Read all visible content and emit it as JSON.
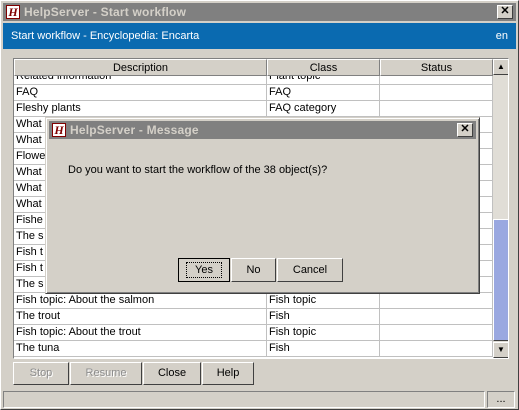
{
  "window": {
    "title": "HelpServer - Start workflow",
    "app_icon": "H",
    "close_glyph": "✕"
  },
  "header": {
    "text": "Start workflow - Encyclopedia: Encarta",
    "lang": "en",
    "background": "#0a6ab0"
  },
  "table": {
    "columns": [
      "Description",
      "Class",
      "Status"
    ],
    "rows": [
      [
        "Related information",
        "Plant topic",
        ""
      ],
      [
        "FAQ",
        "FAQ",
        ""
      ],
      [
        "Fleshy plants",
        "FAQ category",
        ""
      ],
      [
        "What",
        "",
        ""
      ],
      [
        "What",
        "",
        ""
      ],
      [
        "Flowe",
        "",
        ""
      ],
      [
        "What",
        "",
        ""
      ],
      [
        "What",
        "",
        ""
      ],
      [
        "What",
        "",
        ""
      ],
      [
        "Fishe",
        "",
        ""
      ],
      [
        "The s",
        "",
        ""
      ],
      [
        "Fish t",
        "",
        ""
      ],
      [
        "Fish t",
        "",
        ""
      ],
      [
        "The s",
        "",
        ""
      ],
      [
        "Fish topic: About the salmon",
        "Fish topic",
        ""
      ],
      [
        "The trout",
        "Fish",
        ""
      ],
      [
        "Fish topic: About the trout",
        "Fish topic",
        ""
      ],
      [
        "The tuna",
        "Fish",
        ""
      ]
    ]
  },
  "buttons": {
    "stop": "Stop",
    "resume": "Resume",
    "close": "Close",
    "help": "Help"
  },
  "status_bar": {
    "resize_label": "..."
  },
  "dialog": {
    "title": "HelpServer - Message",
    "app_icon": "H",
    "close_glyph": "✕",
    "message": "Do you want to start the workflow of the 38 object(s)?",
    "yes": "Yes",
    "no": "No",
    "cancel": "Cancel"
  }
}
